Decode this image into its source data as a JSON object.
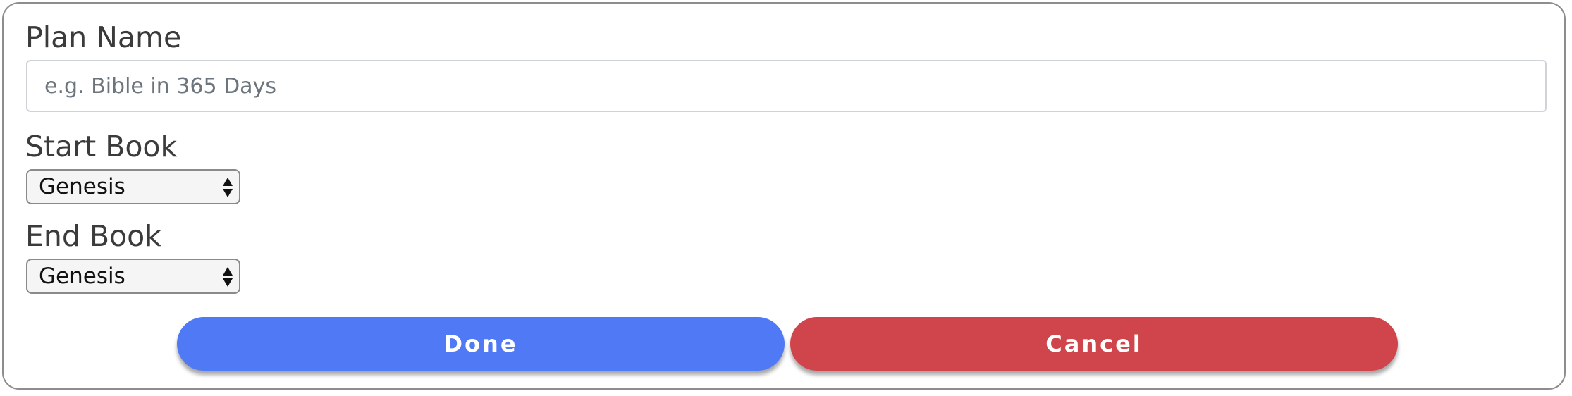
{
  "form": {
    "plan_name_label": "Plan Name",
    "plan_name_placeholder": "e.g. Bible in 365 Days",
    "plan_name_value": "",
    "start_book_label": "Start Book",
    "start_book_value": "Genesis",
    "end_book_label": "End Book",
    "end_book_value": "Genesis"
  },
  "buttons": {
    "done_label": "Done",
    "cancel_label": "Cancel"
  },
  "colors": {
    "done": "#4f79f5",
    "cancel": "#cf454b",
    "label_text": "#3b3b3b",
    "card_border": "#8d8d8d"
  },
  "icons": {
    "select_arrows": "up-down-arrows-icon"
  }
}
